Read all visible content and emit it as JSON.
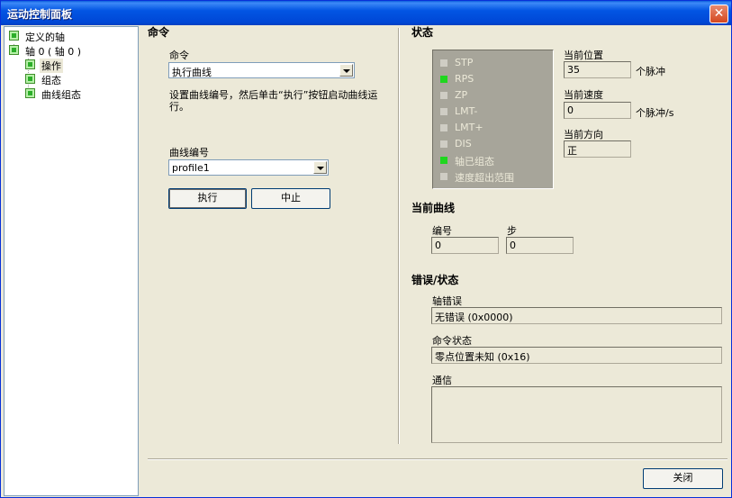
{
  "window": {
    "title": "运动控制面板",
    "close_icon": "close-icon"
  },
  "tree": {
    "items": [
      {
        "label": "定义的轴"
      },
      {
        "label": "轴 0 ( 轴 0 )"
      },
      {
        "label": "操作"
      },
      {
        "label": "组态"
      },
      {
        "label": "曲线组态"
      }
    ]
  },
  "command": {
    "section_title": "命令",
    "command_label": "命令",
    "command_value": "执行曲线",
    "hint": "设置曲线编号，然后单击“执行”按钮启动曲线运行。",
    "hint_line1": "设置曲线编号，然后单击“执行”按钮启动曲线运",
    "hint_line2": "行。",
    "profile_label": "曲线编号",
    "profile_value": "profile1",
    "execute_label": "执行",
    "abort_label": "中止"
  },
  "status": {
    "section_title": "状态",
    "leds": [
      {
        "label": "STP",
        "state": "off"
      },
      {
        "label": "RPS",
        "state": "on"
      },
      {
        "label": "ZP",
        "state": "off"
      },
      {
        "label": "LMT-",
        "state": "off"
      },
      {
        "label": "LMT+",
        "state": "off"
      },
      {
        "label": "DIS",
        "state": "off"
      },
      {
        "label": "轴已组态",
        "state": "on"
      },
      {
        "label": "速度超出范围",
        "state": "off"
      }
    ],
    "position_label": "当前位置",
    "position_value": "35",
    "position_unit": "个脉冲",
    "speed_label": "当前速度",
    "speed_value": "0",
    "speed_unit": "个脉冲/s",
    "direction_label": "当前方向",
    "direction_value": "正"
  },
  "current_profile": {
    "section_title": "当前曲线",
    "number_label": "编号",
    "number_value": "0",
    "step_label": "步",
    "step_value": "0"
  },
  "errors": {
    "section_title": "错误/状态",
    "axis_error_label": "轴错误",
    "axis_error_value": "无错误 (0x0000)",
    "cmd_status_label": "命令状态",
    "cmd_status_value": "零点位置未知 (0x16)",
    "comm_label": "通信",
    "comm_value": ""
  },
  "footer": {
    "close_label": "关闭"
  },
  "colors": {
    "titlebar": "#0255e3",
    "led_on": "#1fd61f",
    "led_off": "#cfcdc4",
    "panel_bg": "#ece9d8"
  }
}
